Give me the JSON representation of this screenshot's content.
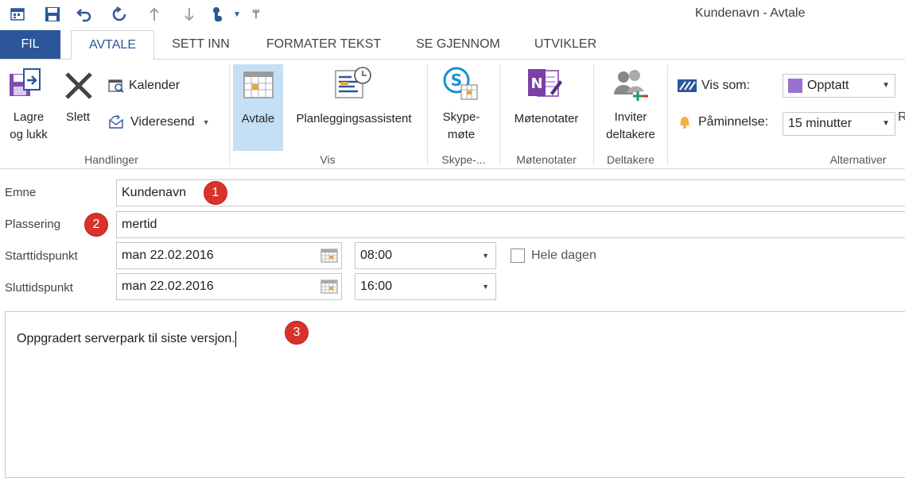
{
  "window": {
    "title": "Kundenavn - Avtale"
  },
  "quick_access": [
    "calendar-app-icon",
    "save-icon",
    "undo-icon",
    "redo-icon",
    "up-arrow-icon",
    "down-arrow-icon",
    "touch-mode-icon",
    "customize-icon"
  ],
  "tabs": {
    "fil": "FIL",
    "avtale": "AVTALE",
    "sett_inn": "SETT INN",
    "formater_tekst": "FORMATER TEKST",
    "se_gjennom": "SE GJENNOM",
    "utvikler": "UTVIKLER"
  },
  "ribbon": {
    "handlinger": {
      "label": "Handlinger",
      "lagre_line1": "Lagre",
      "lagre_line2": "og lukk",
      "slett": "Slett",
      "kalender": "Kalender",
      "videresend": "Videresend"
    },
    "vis": {
      "label": "Vis",
      "avtale": "Avtale",
      "planlegging": "Planleggingsassistent"
    },
    "skype": {
      "label": "Skype-...",
      "line1": "Skype-",
      "line2": "møte"
    },
    "motenotater": {
      "label": "Møtenotater",
      "button": "Møtenotater"
    },
    "deltakere": {
      "label": "Deltakere",
      "line1": "Inviter",
      "line2": "deltakere"
    },
    "alternativer": {
      "label": "Alternativer",
      "vis_som_label": "Vis som:",
      "vis_som_value": "Opptatt",
      "vis_som_color": "#9b6fd1",
      "paaminnelse_label": "Påminnelse:",
      "paaminnelse_value": "15 minutter",
      "overflow_letter": "R"
    }
  },
  "form": {
    "emne_label": "Emne",
    "emne_value": "Kundenavn",
    "plassering_label": "Plassering",
    "plassering_value": "mertid",
    "start_label": "Starttidspunkt",
    "start_date": "man 22.02.2016",
    "start_time": "08:00",
    "hele_dagen_label": "Hele dagen",
    "slutt_label": "Sluttidspunkt",
    "slutt_date": "man 22.02.2016",
    "slutt_time": "16:00",
    "body_text": "Oppgradert serverpark til siste versjon."
  },
  "markers": [
    "1",
    "2",
    "3"
  ],
  "colors": {
    "accent": "#2b579a",
    "marker": "#d9322a",
    "selected": "#c5dff5"
  }
}
